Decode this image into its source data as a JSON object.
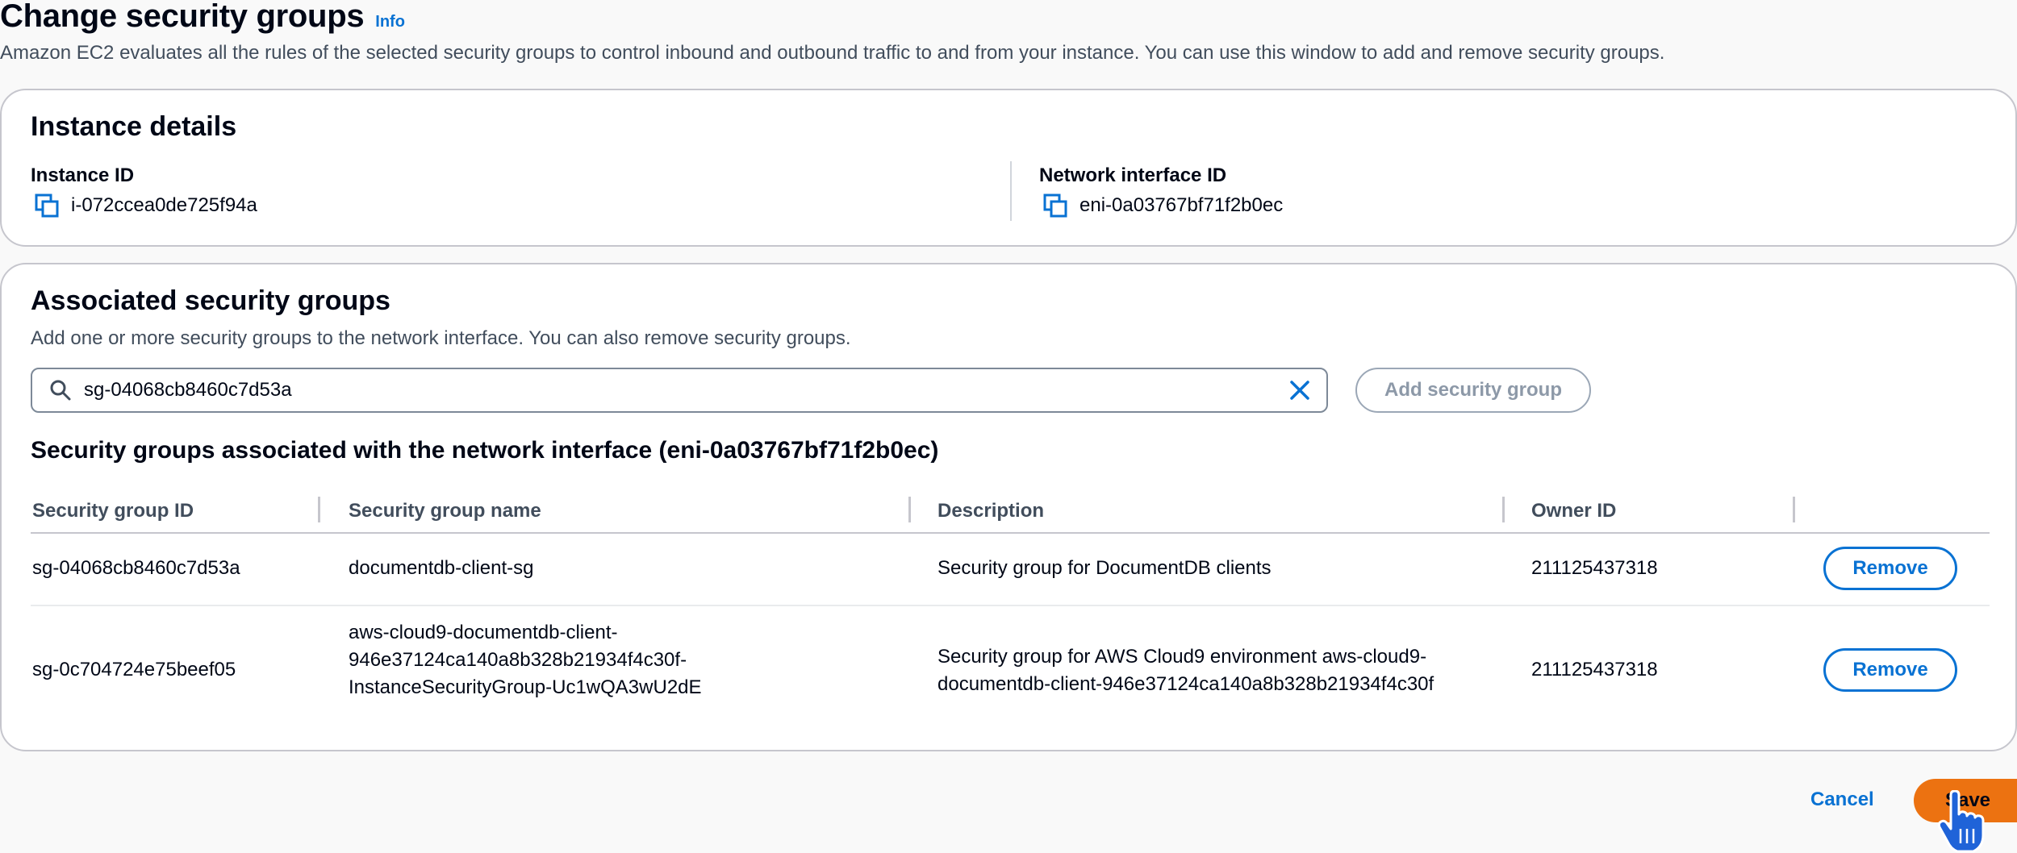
{
  "header": {
    "title": "Change security groups",
    "info_link": "Info",
    "description": "Amazon EC2 evaluates all the rules of the selected security groups to control inbound and outbound traffic to and from your instance. You can use this window to add and remove security groups."
  },
  "instance_details": {
    "heading": "Instance details",
    "instance_id_label": "Instance ID",
    "instance_id_value": "i-072ccea0de725f94a",
    "eni_label": "Network interface ID",
    "eni_value": "eni-0a03767bf71f2b0ec"
  },
  "associated": {
    "heading": "Associated security groups",
    "description": "Add one or more security groups to the network interface. You can also remove security groups.",
    "search_value": "sg-04068cb8460c7d53a",
    "add_button": "Add security group",
    "table_title": "Security groups associated with the network interface (eni-0a03767bf71f2b0ec)",
    "columns": [
      "Security group ID",
      "Security group name",
      "Description",
      "Owner ID"
    ],
    "rows": [
      {
        "id": "sg-04068cb8460c7d53a",
        "name_lines": [
          "documentdb-client-sg"
        ],
        "desc_lines": [
          "Security group for DocumentDB clients"
        ],
        "owner": "211125437318",
        "action": "Remove"
      },
      {
        "id": "sg-0c704724e75beef05",
        "name_lines": [
          "aws-cloud9-documentdb-client-",
          "946e37124ca140a8b328b21934f4c30f-",
          "InstanceSecurityGroup-Uc1wQA3wU2dE"
        ],
        "desc_lines": [
          "Security group for AWS Cloud9 environment aws-cloud9-",
          "documentdb-client-946e37124ca140a8b328b21934f4c30f"
        ],
        "owner": "211125437318",
        "action": "Remove"
      }
    ]
  },
  "footer": {
    "cancel": "Cancel",
    "save": "Save"
  },
  "colors": {
    "link": "#0972d3",
    "primary_button": "#ec7211",
    "border": "#c6c6cd"
  },
  "icons": [
    "copy-icon",
    "search-icon",
    "clear-icon",
    "hand-pointer-icon"
  ]
}
